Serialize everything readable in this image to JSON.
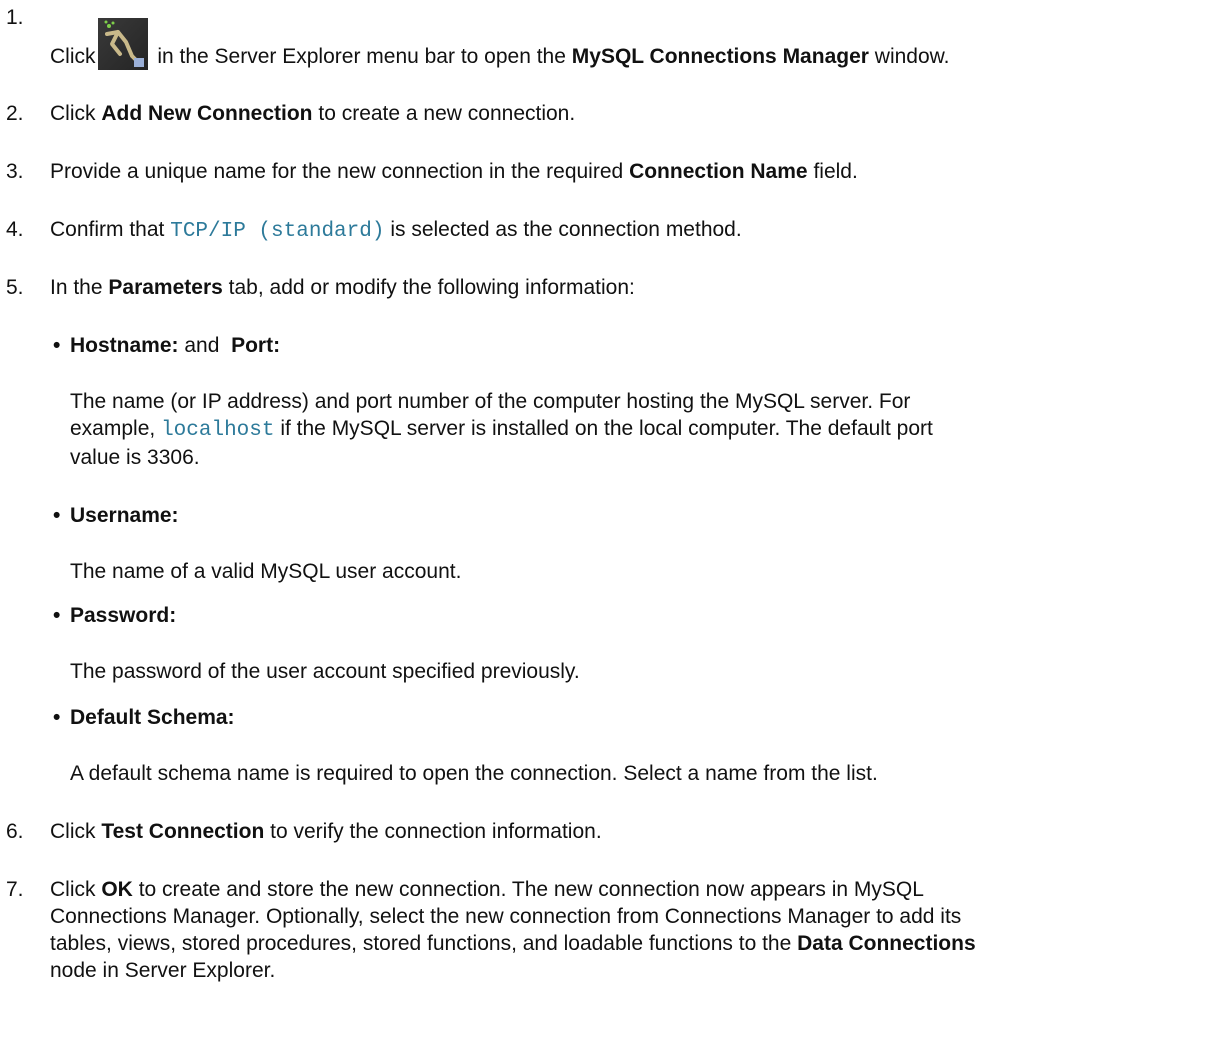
{
  "steps": [
    {
      "number": "1.",
      "parts": [
        "Click",
        "in the Server Explorer menu bar to open the",
        "MySQL Connections Manager",
        "window."
      ],
      "icon": "connection-manager-icon"
    },
    {
      "number": "2.",
      "parts": [
        "Click",
        "Add New Connection",
        "to create a new connection."
      ]
    },
    {
      "number": "3.",
      "parts": [
        "Provide a unique name for the new connection in the required",
        "Connection Name",
        "field."
      ]
    },
    {
      "number": "4.",
      "parts": [
        "Confirm that",
        "TCP/IP (standard)",
        "is selected as the connection method."
      ]
    },
    {
      "number": "5.",
      "parts": [
        "In the",
        "Parameters",
        "tab, add or modify the following information:"
      ]
    },
    {
      "number": "6.",
      "parts": [
        "Click",
        "Test Connection",
        "to verify the connection information."
      ]
    },
    {
      "number": "7.",
      "parts": [
        "Click",
        "OK",
        "to create and store the new connection. The new connection now appears in MySQL",
        "Connections Manager. Optionally, select the new connection from Connections Manager to add its",
        "tables, views, stored procedures, stored functions, and loadable functions to the",
        "Data Connections",
        "node in Server Explorer."
      ]
    }
  ],
  "parameters": [
    {
      "label_parts": [
        "Hostname:",
        "and",
        "Port:"
      ],
      "description_parts": [
        "The name (or IP address) and port number of the computer hosting the MySQL server. For",
        "example,",
        "localhost",
        "if the MySQL server is installed on the local computer. The default port",
        "value is 3306."
      ]
    },
    {
      "label_parts": [
        "Username:"
      ],
      "description_parts": [
        "The name of a valid MySQL user account."
      ]
    },
    {
      "label_parts": [
        "Password:"
      ],
      "description_parts": [
        "The password of the user account specified previously."
      ]
    },
    {
      "label_parts": [
        "Default Schema:"
      ],
      "description_parts": [
        "A default schema name is required to open the connection. Select a name from the list."
      ]
    }
  ],
  "bullet_glyph": "•",
  "colors": {
    "text": "#111111",
    "code": "#2d7a9a",
    "icon_bg": "#2b2b2b",
    "icon_plug": "#c9b98a",
    "icon_accent": "#7fd04a"
  }
}
